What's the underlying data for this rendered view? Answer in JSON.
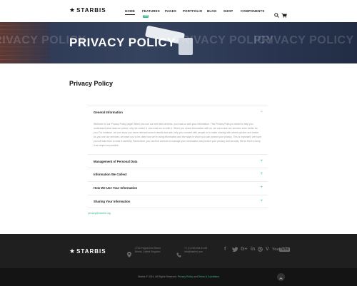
{
  "header": {
    "logo_text": "STARBIS",
    "nav": [
      "HOME",
      "FEATURES",
      "PAGES",
      "PORTFOLIO",
      "BLOG",
      "SHOP",
      "COMPONENTS"
    ],
    "active": "HOME",
    "new_badge": "NEW"
  },
  "hero": {
    "title": "PRIVACY POLICY",
    "ghost_text": "PRIVACY POLICY"
  },
  "main": {
    "heading": "Privacy Policy",
    "accordion": [
      {
        "title": "General Information",
        "expanded": true,
        "body": "Welcome to our Privacy Policy page! When you use our web site services, you trust us with your information. This Privacy Policy is meant to help you understand what data we collect, why we collect it, and what we do with it. When you share information with us, we can make our services even better for you. For instance, we can show you more relevant search results and ads, help you connect with people or to make sharing with others quicker and easier. As you use our services, we want you to be clear how we're using information and the ways in which you can protect your privacy. This is important; we hope you will take time to read it carefully. Remember, you can find controls to manage your information and protect your privacy and security. We've tried to keep it as simple as possible."
      },
      {
        "title": "Management of Personal Data",
        "expanded": false
      },
      {
        "title": "Information We Collect",
        "expanded": false
      },
      {
        "title": "How We Use Your Information",
        "expanded": false
      },
      {
        "title": "Sharing Your Information",
        "expanded": false
      }
    ],
    "email_link": "privacy@starbis.org"
  },
  "footer": {
    "logo_text": "STARBIS",
    "address_line1": "2732 Peppermint Street",
    "address_line2": "Bristol, United Kingdom",
    "phone": "+1 (7) 293-934-91-98",
    "email": "info@starbis.com",
    "social": [
      "facebook",
      "twitter",
      "google-plus",
      "linkedin",
      "dribbble",
      "vimeo",
      "youtube"
    ],
    "copyright_prefix": "Starbis © 2016. All Rights Reserved.",
    "privacy_link": "Privacy Policy",
    "and": "and",
    "terms_link": "Terms & Conditions"
  },
  "colors": {
    "accent": "#3cb88f",
    "hero_bg": "#2c3853",
    "footer_bg": "#1f1f1f",
    "bottom_bg": "#141414"
  }
}
